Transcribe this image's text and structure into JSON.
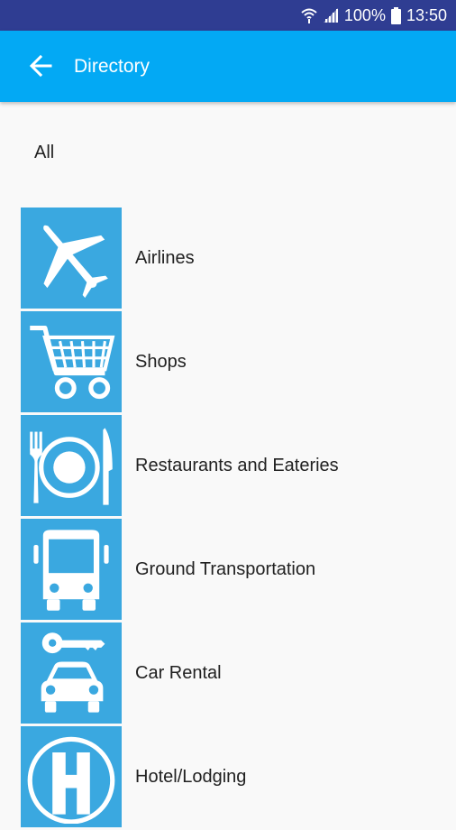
{
  "status_bar": {
    "battery": "100%",
    "time": "13:50",
    "icons": [
      "wifi-icon",
      "signal-icon",
      "battery-icon"
    ]
  },
  "app_bar": {
    "title": "Directory",
    "back_icon": "arrow-back-icon",
    "color": "#03a9f4"
  },
  "filter": {
    "label": "All"
  },
  "directory": {
    "tile_color": "#3aa8e0",
    "items": [
      {
        "label": "Airlines",
        "icon": "airplane-icon"
      },
      {
        "label": "Shops",
        "icon": "shopping-cart-icon"
      },
      {
        "label": "Restaurants and Eateries",
        "icon": "restaurant-icon"
      },
      {
        "label": "Ground Transportation",
        "icon": "bus-icon"
      },
      {
        "label": "Car Rental",
        "icon": "car-rental-icon"
      },
      {
        "label": "Hotel/Lodging",
        "icon": "hotel-icon"
      }
    ]
  }
}
